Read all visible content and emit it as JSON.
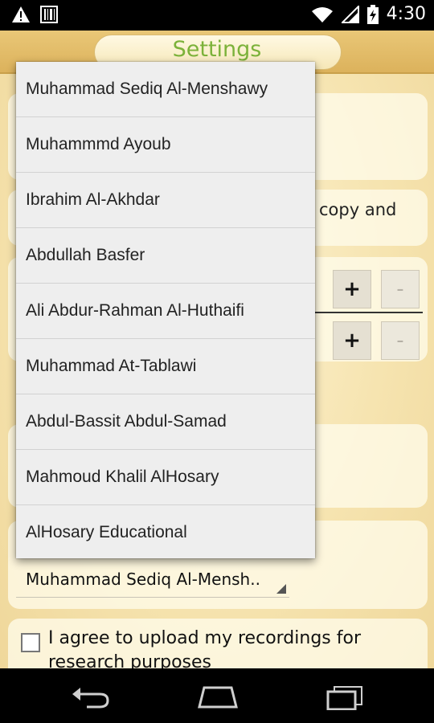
{
  "status_bar": {
    "time": "4:30",
    "icons": [
      "warning-icon",
      "barcode-icon",
      "wifi-icon",
      "signal-icon",
      "battery-charging-icon"
    ]
  },
  "header": {
    "title": "Settings"
  },
  "background_partials": {
    "copy_text": "copy and"
  },
  "steppers": [
    {
      "plus": "+",
      "minus": "-"
    },
    {
      "plus": "+",
      "minus": "-"
    }
  ],
  "reciter_spinner": {
    "selected": "Muhammad Sediq Al-Mensh.."
  },
  "upload_consent": {
    "label": "I agree to upload my recordings for research purposes",
    "checked": false
  },
  "dropdown": {
    "items": [
      "Muhammad Sediq Al-Menshawy",
      "Muhammmd Ayoub",
      "Ibrahim Al-Akhdar",
      "Abdullah Basfer",
      "Ali Abdur-Rahman Al-Huthaifi",
      "Muhammad At-Tablawi",
      "Abdul-Bassit Abdul-Samad",
      "Mahmoud Khalil AlHosary",
      "AlHosary Educational"
    ]
  },
  "nav_bar": {
    "icons": [
      "back-icon",
      "home-icon",
      "recent-apps-icon"
    ]
  },
  "colors": {
    "title": "#7cb23a",
    "header_bg": "#dcb25c",
    "dropdown_bg": "#eeeeee"
  }
}
